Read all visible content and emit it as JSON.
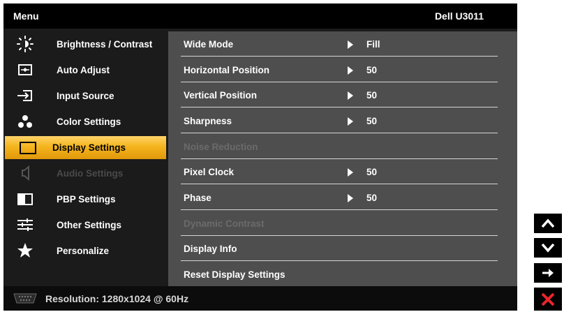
{
  "header": {
    "title": "Menu",
    "model": "Dell U3011"
  },
  "sidebar": {
    "items": [
      {
        "label": "Brightness / Contrast",
        "icon": "brightness-icon",
        "state": "normal"
      },
      {
        "label": "Auto Adjust",
        "icon": "auto-adjust-icon",
        "state": "normal"
      },
      {
        "label": "Input Source",
        "icon": "input-source-icon",
        "state": "normal"
      },
      {
        "label": "Color Settings",
        "icon": "color-settings-icon",
        "state": "normal"
      },
      {
        "label": "Display Settings",
        "icon": "display-settings-icon",
        "state": "selected"
      },
      {
        "label": "Audio Settings",
        "icon": "speaker-icon",
        "state": "disabled"
      },
      {
        "label": "PBP Settings",
        "icon": "pbp-icon",
        "state": "normal"
      },
      {
        "label": "Other Settings",
        "icon": "sliders-icon",
        "state": "normal"
      },
      {
        "label": "Personalize",
        "icon": "star-icon",
        "state": "normal"
      }
    ]
  },
  "content": {
    "rows": [
      {
        "label": "Wide Mode",
        "value": "Fill",
        "enabled": true
      },
      {
        "label": "Horizontal Position",
        "value": "50",
        "enabled": true
      },
      {
        "label": "Vertical Position",
        "value": "50",
        "enabled": true
      },
      {
        "label": "Sharpness",
        "value": "50",
        "enabled": true
      },
      {
        "label": "Noise Reduction",
        "value": "",
        "enabled": false
      },
      {
        "label": "Pixel Clock",
        "value": "50",
        "enabled": true
      },
      {
        "label": "Phase",
        "value": "50",
        "enabled": true
      },
      {
        "label": "Dynamic Contrast",
        "value": "",
        "enabled": false
      },
      {
        "label": "Display Info",
        "value": "",
        "enabled": true
      },
      {
        "label": "Reset Display Settings",
        "value": "",
        "enabled": true
      }
    ]
  },
  "footer": {
    "input_icon": "vga-connector-icon",
    "resolution": "Resolution: 1280x1024 @ 60Hz"
  },
  "nav_buttons": [
    {
      "icon": "chevron-up-icon",
      "color": "#ffffff"
    },
    {
      "icon": "chevron-down-icon",
      "color": "#ffffff"
    },
    {
      "icon": "arrow-right-icon",
      "color": "#ffffff"
    },
    {
      "icon": "close-icon",
      "color": "#e8262a"
    }
  ],
  "colors": {
    "accent": "#f5b51e",
    "panel": "#4e4e4e",
    "sidebar": "#1b1b1b",
    "header": "#000000"
  }
}
